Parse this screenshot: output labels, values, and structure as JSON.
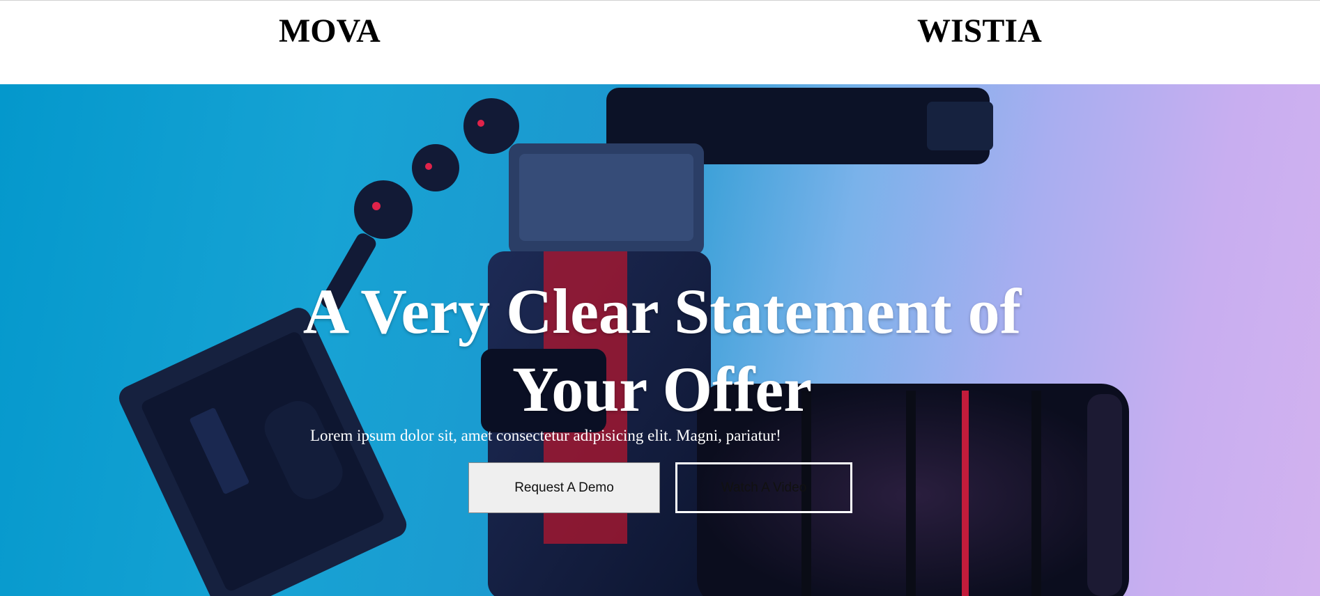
{
  "header": {
    "brand_left": "MOVA",
    "brand_right": "WISTIA"
  },
  "hero": {
    "headline": "A Very Clear Statement of Your Offer",
    "subtext": "Lorem ipsum dolor sit, amet consectetur adipisicing elit. Magni, pariatur!",
    "primary_button": "Request A Demo",
    "secondary_button": "Watch A Video",
    "background_image": "camera-rig-photo",
    "colors": {
      "gradient_start": "#0498cc",
      "gradient_end": "#d2b2ef",
      "headline": "#ffffff"
    }
  }
}
